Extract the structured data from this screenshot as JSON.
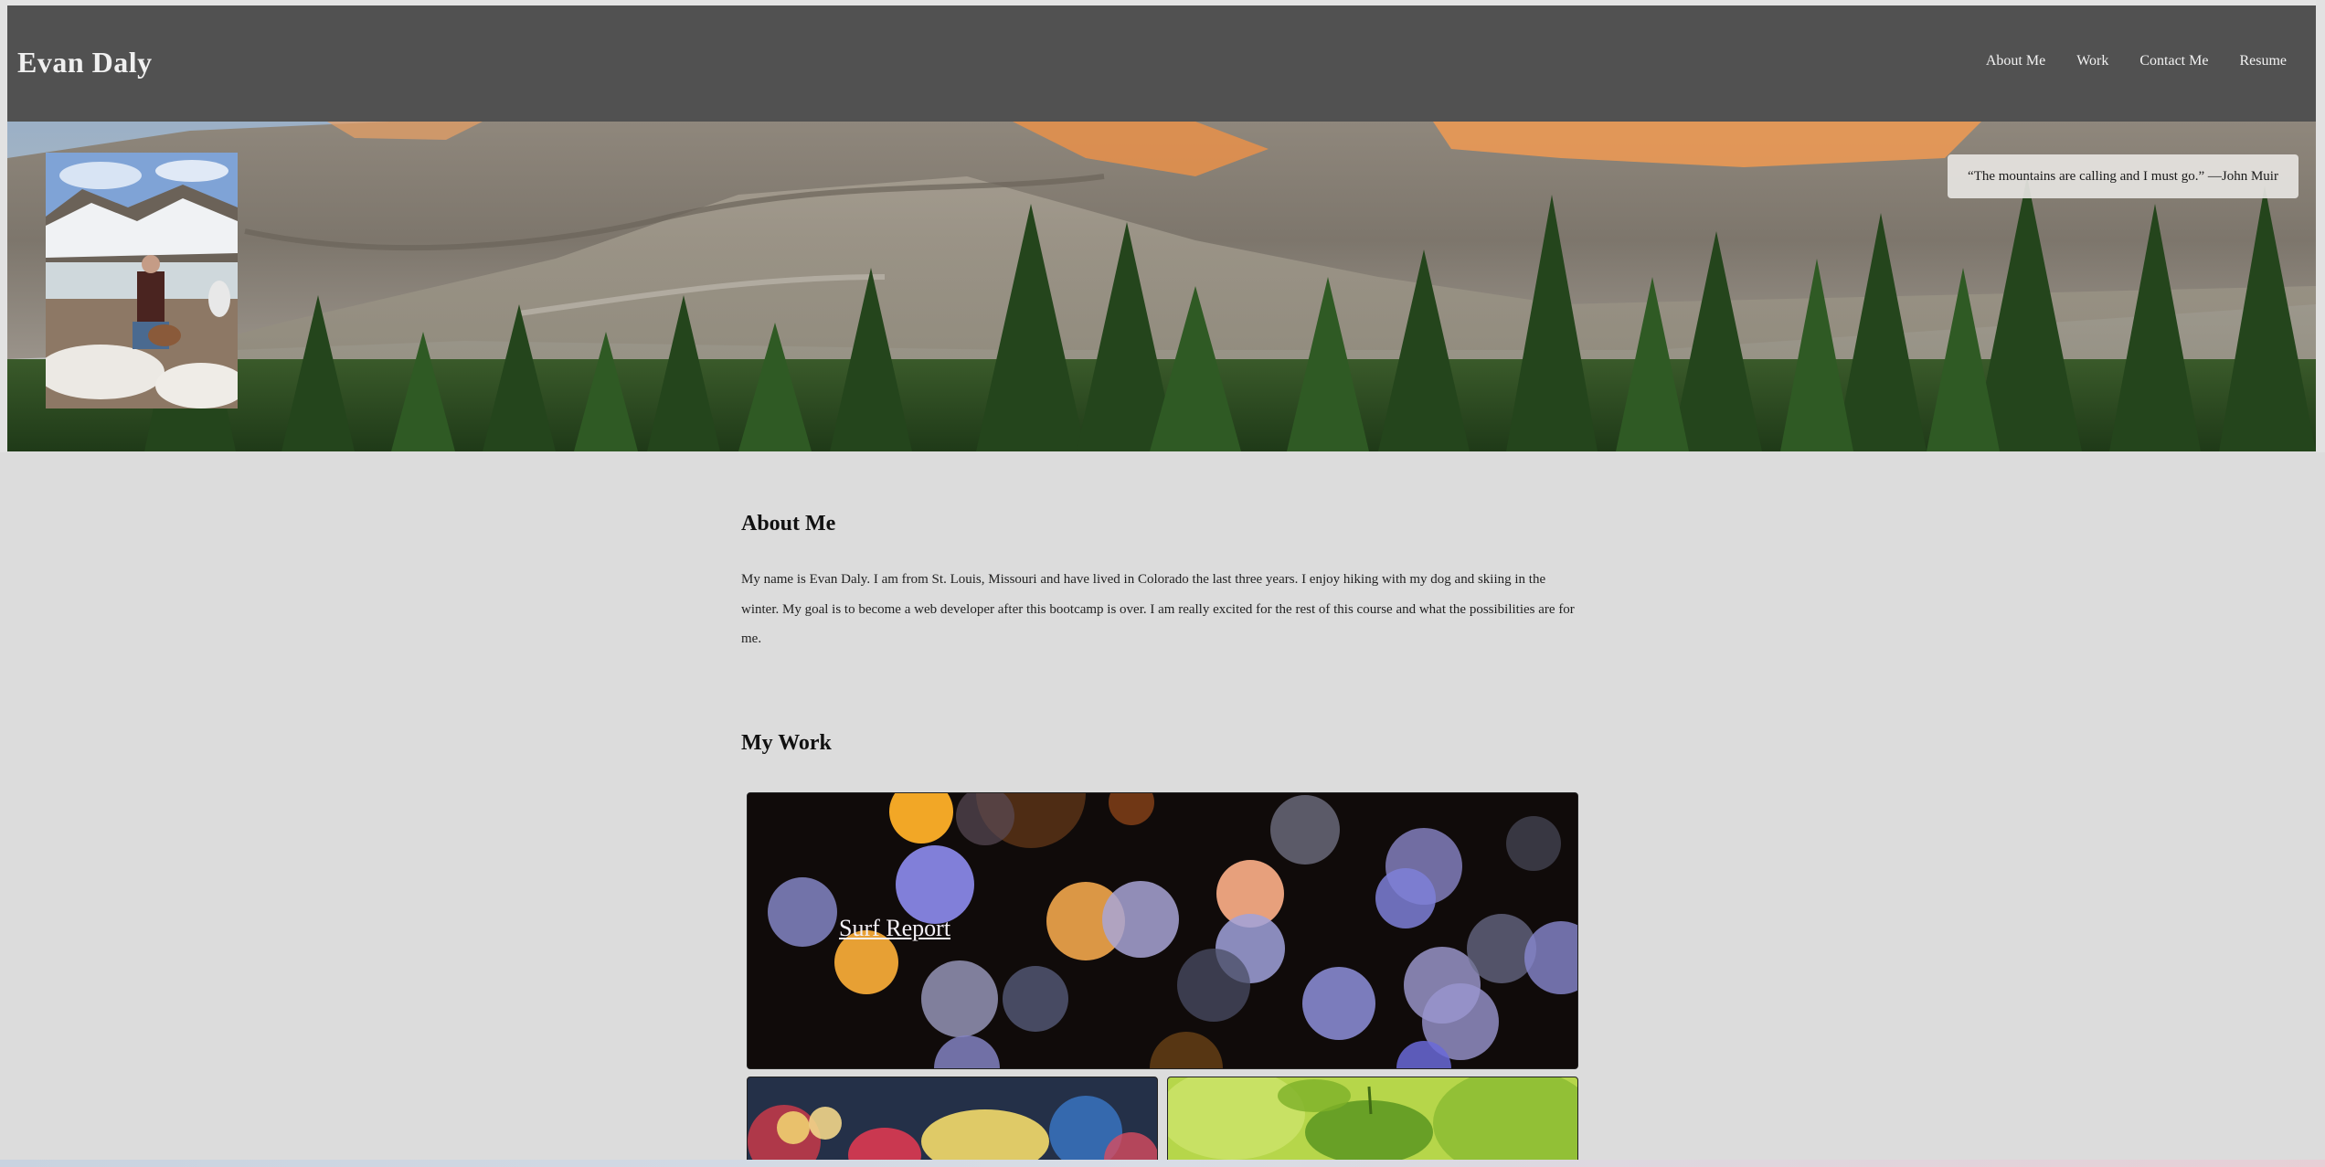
{
  "navbar": {
    "brand": "Evan Daly",
    "links": [
      {
        "label": "About Me"
      },
      {
        "label": "Work"
      },
      {
        "label": "Contact Me"
      },
      {
        "label": "Resume"
      }
    ]
  },
  "hero": {
    "quote": "“The mountains are calling and I must go.” —John Muir"
  },
  "about": {
    "heading": "About Me",
    "text": "My name is Evan Daly. I am from St. Louis, Missouri and have lived in Colorado the last three years. I enjoy hiking with my dog and skiing in the winter. My goal is to become a web developer after this bootcamp is over. I am really excited for the rest of this course and what the possibilities are for me."
  },
  "work": {
    "heading": "My Work",
    "projects": [
      {
        "label": "Surf Report"
      }
    ]
  },
  "colors": {
    "navbar": "#515151",
    "page_background": "#dcdcdc",
    "text": "#111111"
  }
}
